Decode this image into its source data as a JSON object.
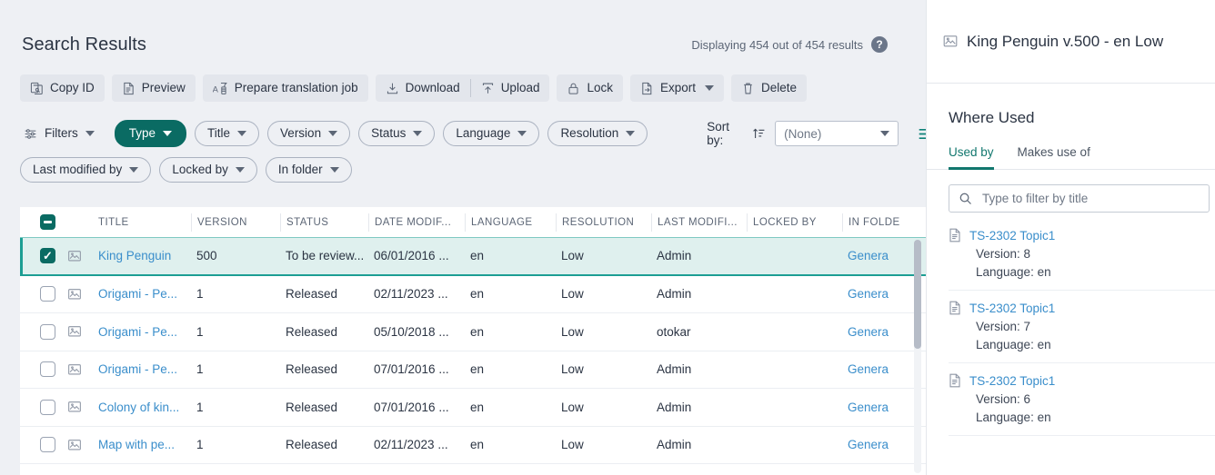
{
  "left": {
    "title": "Search Results",
    "results_summary": "Displaying 454 out of 454 results",
    "help_label": "?",
    "toolbar": [
      {
        "label": "Copy ID",
        "icon": "copy-id-icon"
      },
      {
        "label": "Preview",
        "icon": "preview-icon"
      },
      {
        "label": "Prepare translation job",
        "icon": "translation-job-icon"
      },
      {
        "label": "Download",
        "icon": "download-icon"
      },
      {
        "label": "Upload",
        "icon": "upload-icon"
      },
      {
        "label": "Lock",
        "icon": "lock-icon"
      },
      {
        "label": "Export",
        "icon": "export-icon"
      },
      {
        "label": "Delete",
        "icon": "trash-icon"
      }
    ],
    "filters_row1": [
      {
        "label": "Filters",
        "style": "plain",
        "icon": "filters-icon"
      },
      {
        "label": "Type",
        "style": "active"
      },
      {
        "label": "Title",
        "style": "outline"
      },
      {
        "label": "Version",
        "style": "outline"
      },
      {
        "label": "Status",
        "style": "outline"
      },
      {
        "label": "Language",
        "style": "outline"
      },
      {
        "label": "Resolution",
        "style": "outline"
      }
    ],
    "filters_row2": [
      {
        "label": "Last modified by",
        "style": "outline"
      },
      {
        "label": "Locked by",
        "style": "outline"
      },
      {
        "label": "In folder",
        "style": "outline"
      }
    ],
    "sort": {
      "label": "Sort by:",
      "direction_icon": "sort-ascending-icon",
      "value": "(None)",
      "list_view_icon": "list-view-icon",
      "grid_view_icon": "grid-view-icon"
    },
    "table": {
      "columns": [
        "TITLE",
        "VERSION",
        "STATUS",
        "DATE MODIF...",
        "LANGUAGE",
        "RESOLUTION",
        "LAST MODIFI...",
        "LOCKED BY",
        "IN FOLDE"
      ],
      "select_all_state": "indeterminate",
      "rows": [
        {
          "selected": true,
          "title": "King Penguin",
          "version": "500",
          "status": "To be review...",
          "date_modified": "06/01/2016 ...",
          "language": "en",
          "resolution": "Low",
          "last_modified_by": "Admin",
          "locked_by": "",
          "in_folder": "Genera"
        },
        {
          "selected": false,
          "title": "Origami - Pe...",
          "version": "1",
          "status": "Released",
          "date_modified": "02/11/2023 ...",
          "language": "en",
          "resolution": "Low",
          "last_modified_by": "Admin",
          "locked_by": "",
          "in_folder": "Genera"
        },
        {
          "selected": false,
          "title": "Origami - Pe...",
          "version": "1",
          "status": "Released",
          "date_modified": "05/10/2018 ...",
          "language": "en",
          "resolution": "Low",
          "last_modified_by": "otokar",
          "locked_by": "",
          "in_folder": "Genera"
        },
        {
          "selected": false,
          "title": "Origami - Pe...",
          "version": "1",
          "status": "Released",
          "date_modified": "07/01/2016 ...",
          "language": "en",
          "resolution": "Low",
          "last_modified_by": "Admin",
          "locked_by": "",
          "in_folder": "Genera"
        },
        {
          "selected": false,
          "title": "Colony of kin...",
          "version": "1",
          "status": "Released",
          "date_modified": "07/01/2016 ...",
          "language": "en",
          "resolution": "Low",
          "last_modified_by": "Admin",
          "locked_by": "",
          "in_folder": "Genera"
        },
        {
          "selected": false,
          "title": "Map with pe...",
          "version": "1",
          "status": "Released",
          "date_modified": "02/11/2023 ...",
          "language": "en",
          "resolution": "Low",
          "last_modified_by": "Admin",
          "locked_by": "",
          "in_folder": "Genera"
        }
      ]
    }
  },
  "right": {
    "header_title": "King Penguin v.500 - en Low",
    "header_icon": "image-icon",
    "section_title": "Where Used",
    "tabs": [
      {
        "label": "Used by",
        "active": true
      },
      {
        "label": "Makes use of",
        "active": false
      }
    ],
    "search_placeholder": "Type to filter by title",
    "search_value": "",
    "items": [
      {
        "title": "TS-2302 Topic1",
        "version": "Version: 8",
        "language": "Language: en"
      },
      {
        "title": "TS-2302 Topic1",
        "version": "Version: 7",
        "language": "Language: en"
      },
      {
        "title": "TS-2302 Topic1",
        "version": "Version: 6",
        "language": "Language: en"
      }
    ]
  },
  "colors": {
    "accent_teal": "#0a6b63",
    "selection_bg": "#dff0ee",
    "link_blue": "#3a8ecb",
    "panel_bg": "#eef0f4"
  }
}
